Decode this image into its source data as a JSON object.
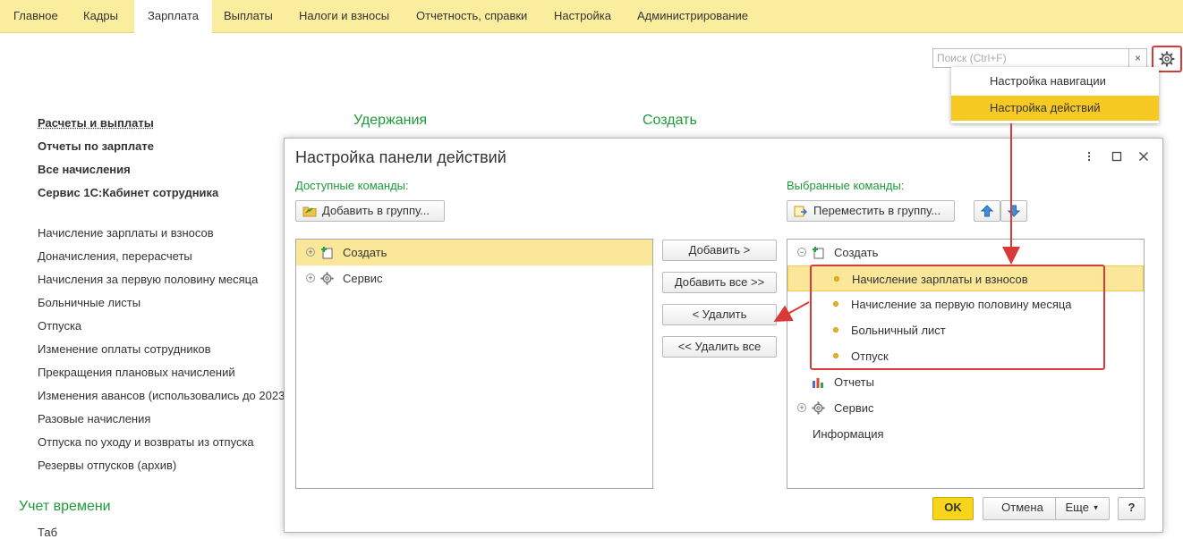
{
  "menu": {
    "tabs": [
      "Главное",
      "Кадры",
      "Зарплата",
      "Выплаты",
      "Налоги и взносы",
      "Отчетность, справки",
      "Настройка",
      "Администрирование"
    ],
    "active_tab": "Зарплата"
  },
  "search": {
    "placeholder": "Поиск (Ctrl+F)",
    "clear": "×"
  },
  "dropdown": {
    "items": [
      "Настройка навигации",
      "Настройка действий"
    ]
  },
  "left_menu": {
    "bold_items": [
      "Расчеты и выплаты",
      "Отчеты по зарплате",
      "Все начисления",
      "Сервис 1С:Кабинет сотрудника"
    ],
    "items": [
      "Начисление зарплаты и взносов",
      "Доначисления, перерасчеты",
      "Начисления за первую половину месяца",
      "Больничные листы",
      "Отпуска",
      "Изменение оплаты сотрудников",
      "Прекращения плановых начислений",
      "Изменения авансов (использовались до 2023",
      "Разовые начисления",
      "Отпуска по уходу и возвраты из отпуска",
      "Резервы отпусков (архив)"
    ],
    "section_time": "Учет времени",
    "cut_item": "Таб"
  },
  "sections": {
    "deductions": "Удержания",
    "create": "Создать"
  },
  "modal": {
    "title": "Настройка панели действий",
    "available_label": "Доступные команды:",
    "selected_label": "Выбранные команды:",
    "add_to_group": "Добавить в группу...",
    "move_to_group": "Переместить в группу...",
    "available": [
      {
        "label": "Создать",
        "icon": "create-icon"
      },
      {
        "label": "Сервис",
        "icon": "gear-icon"
      }
    ],
    "buttons": {
      "add": "Добавить >",
      "add_all": "Добавить все >>",
      "remove": "< Удалить",
      "remove_all": "<< Удалить все"
    },
    "selected": {
      "create": "Создать",
      "children": [
        "Начисление зарплаты и взносов",
        "Начисление за первую половину месяца",
        "Больничный лист",
        "Отпуск"
      ],
      "reports": "Отчеты",
      "service": "Сервис",
      "info": "Информация"
    },
    "footer": {
      "ok": "OK",
      "cancel": "Отмена",
      "more": "Еще",
      "help": "?"
    }
  },
  "colors": {
    "menu_bg": "#fbed9e",
    "highlight": "#f7c923",
    "green": "#1d9a3a",
    "annotation_red": "#d83a3a"
  }
}
